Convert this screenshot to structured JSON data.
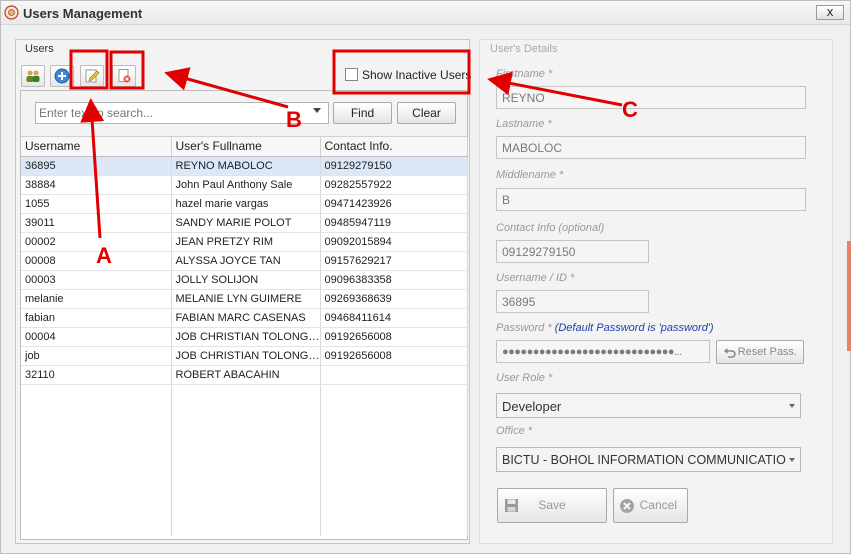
{
  "window": {
    "title": "Users Management",
    "close_glyph": "x"
  },
  "users_panel": {
    "group_title": "Users",
    "toolbar": {
      "icons": [
        "users-icon",
        "add-icon",
        "edit-icon",
        "delete-icon"
      ]
    },
    "show_inactive_label": "Show Inactive Users",
    "show_inactive_checked": false,
    "search": {
      "placeholder": "Enter text to search...",
      "find_label": "Find",
      "clear_label": "Clear"
    },
    "table": {
      "columns": [
        "Username",
        "User's Fullname",
        "Contact Info."
      ],
      "selected_index": 0,
      "rows": [
        [
          "36895",
          "REYNO MABOLOC",
          "09129279150"
        ],
        [
          "38884",
          "John Paul Anthony Sale",
          "09282557922"
        ],
        [
          "1055",
          "hazel marie vargas",
          "09471423926"
        ],
        [
          "39011",
          "SANDY MARIE POLOT",
          "09485947119"
        ],
        [
          "00002",
          "JEAN PRETZY RIM",
          "09092015894"
        ],
        [
          "00008",
          "ALYSSA JOYCE TAN",
          "09157629217"
        ],
        [
          "00003",
          "JOLLY SOLIJON",
          "09096383358"
        ],
        [
          "melanie",
          "MELANIE LYN GUIMERE",
          "09269368639"
        ],
        [
          "fabian",
          "FABIAN MARC CASENAS",
          "09468411614"
        ],
        [
          "00004",
          "JOB CHRISTIAN TOLONGH...",
          "09192656008"
        ],
        [
          "job",
          "JOB CHRISTIAN TOLONGH...",
          "09192656008"
        ],
        [
          "32110",
          "ROBERT ABACAHIN",
          ""
        ]
      ]
    }
  },
  "details_panel": {
    "group_title": "User's Details",
    "firstname": {
      "label": "Firstname *",
      "value": "REYNO"
    },
    "lastname": {
      "label": "Lastname *",
      "value": "MABOLOC"
    },
    "middlename": {
      "label": "Middlename *",
      "value": "B"
    },
    "contact": {
      "label": "Contact Info (optional)",
      "value": "09129279150"
    },
    "username": {
      "label": "Username / ID *",
      "value": "36895"
    },
    "password": {
      "label": "Password *",
      "note": "(Default Password is 'password')",
      "value": "●●●●●●●●●●●●●●●●●●●●●●●●●●●●...",
      "reset_label": "Reset Pass."
    },
    "user_role": {
      "label": "User Role *",
      "value": "Developer"
    },
    "office": {
      "label": "Office *",
      "value": "BICTU - BOHOL INFORMATION COMMUNICATIO"
    },
    "save_label": "Save",
    "cancel_label": "Cancel"
  },
  "annotations": {
    "a": "A",
    "b": "B",
    "c": "C",
    "color": "#e00000"
  }
}
